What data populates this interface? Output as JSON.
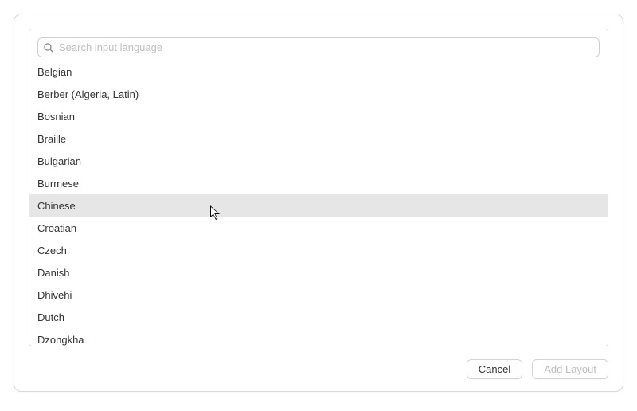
{
  "search": {
    "placeholder": "Search input language",
    "value": ""
  },
  "languages": [
    {
      "label": "Belgian",
      "hovered": false
    },
    {
      "label": "Berber (Algeria, Latin)",
      "hovered": false
    },
    {
      "label": "Bosnian",
      "hovered": false
    },
    {
      "label": "Braille",
      "hovered": false
    },
    {
      "label": "Bulgarian",
      "hovered": false
    },
    {
      "label": "Burmese",
      "hovered": false
    },
    {
      "label": "Chinese",
      "hovered": true
    },
    {
      "label": "Croatian",
      "hovered": false
    },
    {
      "label": "Czech",
      "hovered": false
    },
    {
      "label": "Danish",
      "hovered": false
    },
    {
      "label": "Dhivehi",
      "hovered": false
    },
    {
      "label": "Dutch",
      "hovered": false
    },
    {
      "label": "Dzongkha",
      "hovered": false
    }
  ],
  "buttons": {
    "cancel": "Cancel",
    "add_layout": "Add Layout"
  }
}
